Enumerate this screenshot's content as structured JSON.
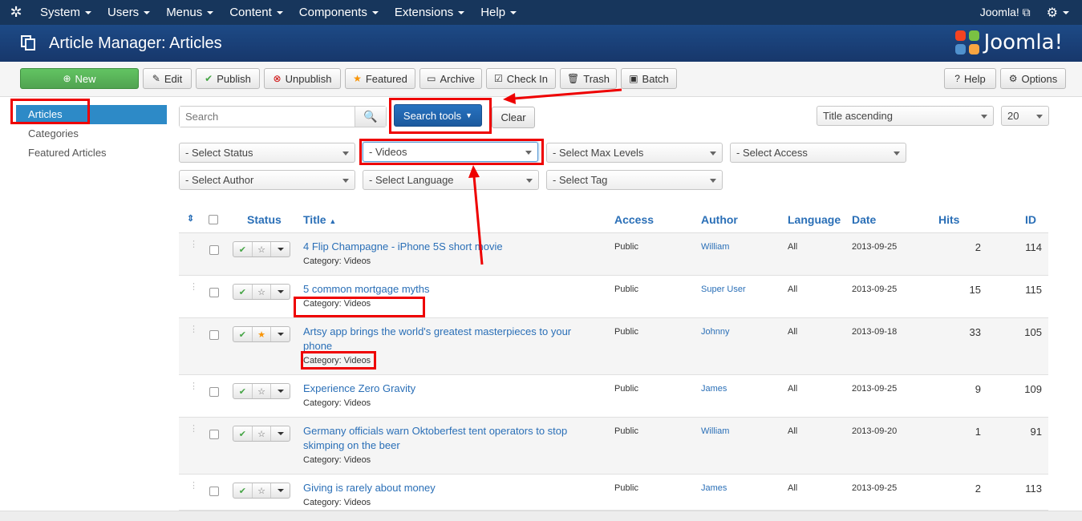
{
  "nav": {
    "items": [
      "System",
      "Users",
      "Menus",
      "Content",
      "Components",
      "Extensions",
      "Help"
    ],
    "site_label": "Joomla!",
    "site_icon": "external-link-icon",
    "settings_icon": "gear-icon"
  },
  "header": {
    "title": "Article Manager: Articles",
    "brand": "Joomla!"
  },
  "toolbar": {
    "new": "New",
    "edit": "Edit",
    "publish": "Publish",
    "unpublish": "Unpublish",
    "featured": "Featured",
    "archive": "Archive",
    "checkin": "Check In",
    "trash": "Trash",
    "batch": "Batch",
    "help": "Help",
    "options": "Options"
  },
  "sidebar": {
    "items": [
      "Articles",
      "Categories",
      "Featured Articles"
    ],
    "active": "Articles"
  },
  "filters": {
    "search_placeholder": "Search",
    "search_tools": "Search tools",
    "clear": "Clear",
    "ordering": "Title ascending",
    "limit": "20",
    "status": "- Select Status",
    "category": "- Videos",
    "max_levels": "- Select Max Levels",
    "access": "- Select Access",
    "author": "- Select Author",
    "language": "- Select Language",
    "tag": "- Select Tag"
  },
  "table": {
    "headers": {
      "status": "Status",
      "title": "Title",
      "access": "Access",
      "author": "Author",
      "language": "Language",
      "date": "Date",
      "hits": "Hits",
      "id": "ID"
    },
    "rows": [
      {
        "title": "4 Flip Champagne - iPhone 5S short movie",
        "category": "Category: Videos",
        "access": "Public",
        "author": "William",
        "language": "All",
        "date": "2013-09-25",
        "hits": "2",
        "id": "114",
        "featured": false
      },
      {
        "title": "5 common mortgage myths",
        "category": "Category: Videos",
        "access": "Public",
        "author": "Super User",
        "language": "All",
        "date": "2013-09-25",
        "hits": "15",
        "id": "115",
        "featured": false
      },
      {
        "title": "Artsy app brings the world's greatest masterpieces to your phone",
        "category": "Category: Videos",
        "access": "Public",
        "author": "Johnny",
        "language": "All",
        "date": "2013-09-18",
        "hits": "33",
        "id": "105",
        "featured": true
      },
      {
        "title": "Experience Zero Gravity",
        "category": "Category: Videos",
        "access": "Public",
        "author": "James",
        "language": "All",
        "date": "2013-09-25",
        "hits": "9",
        "id": "109",
        "featured": false
      },
      {
        "title": "Germany officials warn Oktoberfest tent operators to stop skimping on the beer",
        "category": "Category: Videos",
        "access": "Public",
        "author": "William",
        "language": "All",
        "date": "2013-09-20",
        "hits": "1",
        "id": "91",
        "featured": false
      },
      {
        "title": "Giving is rarely about money",
        "category": "Category: Videos",
        "access": "Public",
        "author": "James",
        "language": "All",
        "date": "2013-09-25",
        "hits": "2",
        "id": "113",
        "featured": false
      }
    ]
  },
  "colors": {
    "navbar": "#17365c",
    "header": "#1d4a86",
    "link": "#2a6fb7",
    "active": "#2d8ac7",
    "annotation": "#e00000"
  }
}
